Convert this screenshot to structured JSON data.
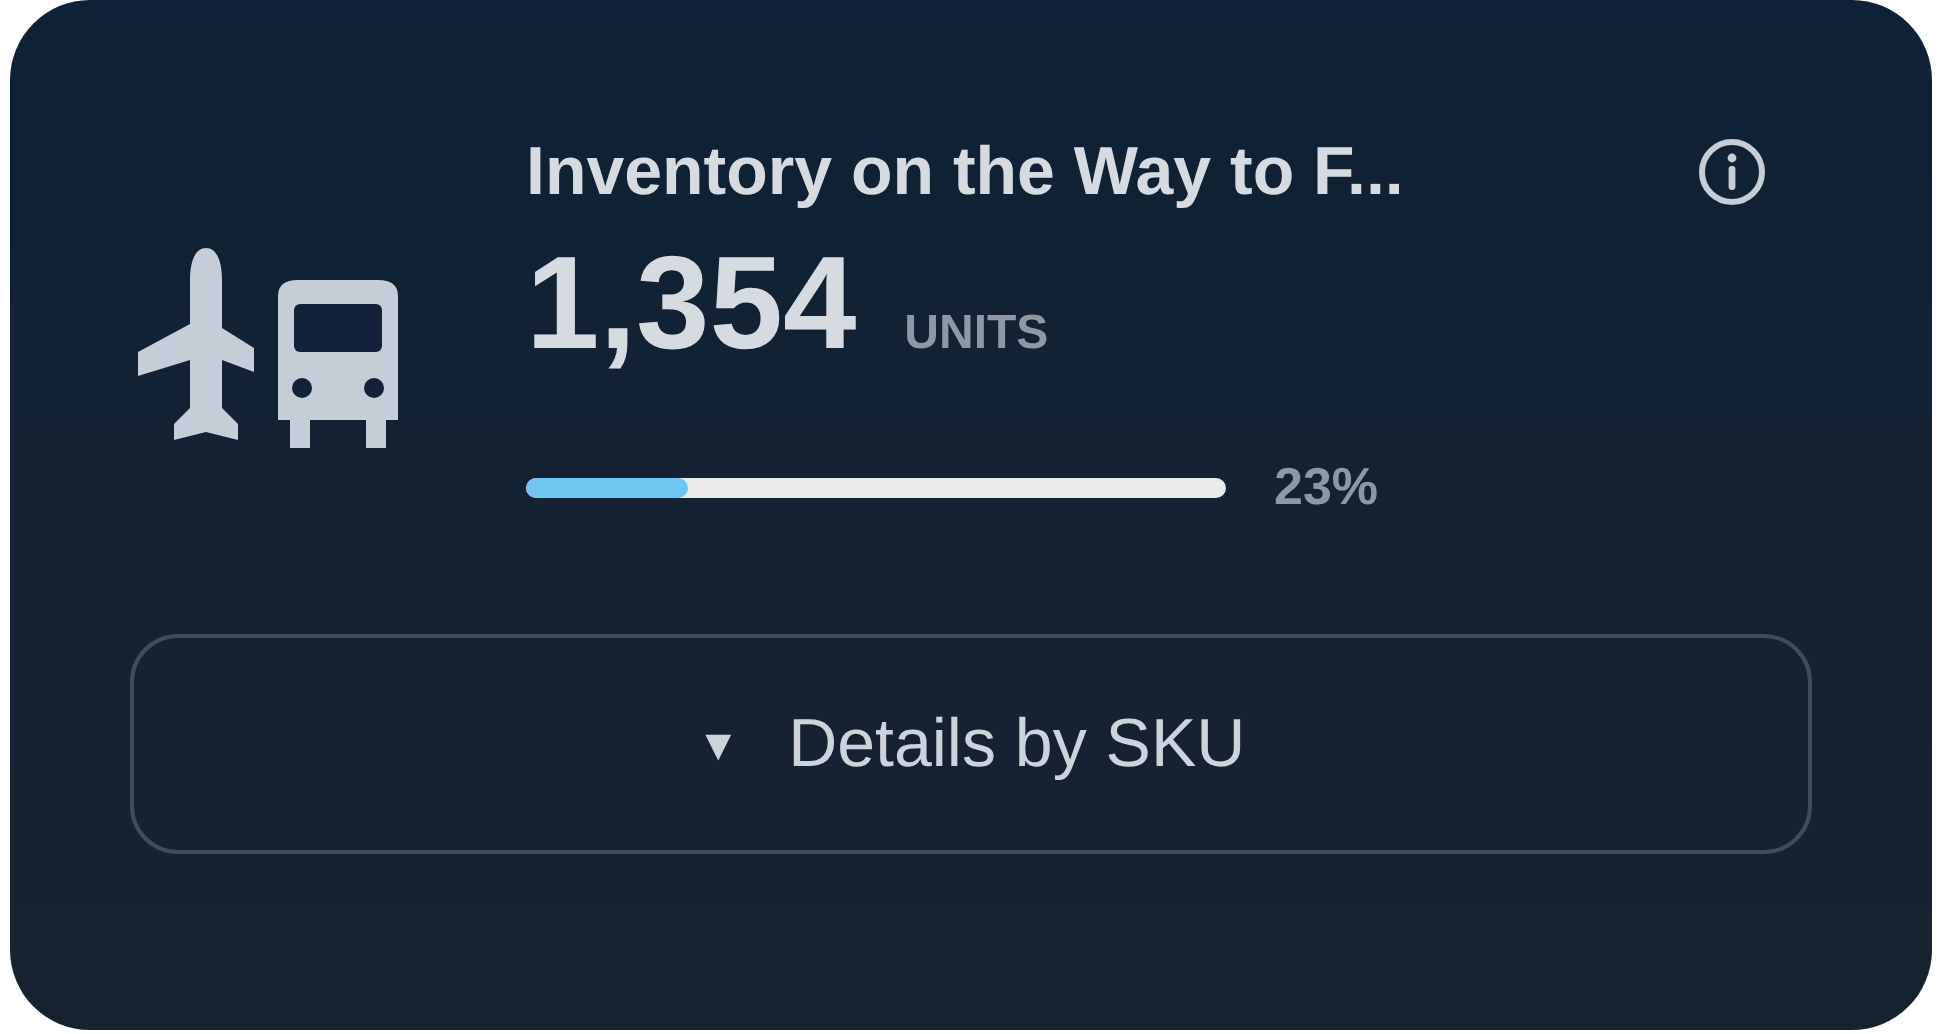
{
  "card": {
    "title": "Inventory on the Way to F...",
    "value": "1,354",
    "unit": "UNITS",
    "progress": {
      "level": 0.23,
      "reading": "23%"
    },
    "button": {
      "icon": "▼",
      "label": "Details by SKU"
    }
  }
}
